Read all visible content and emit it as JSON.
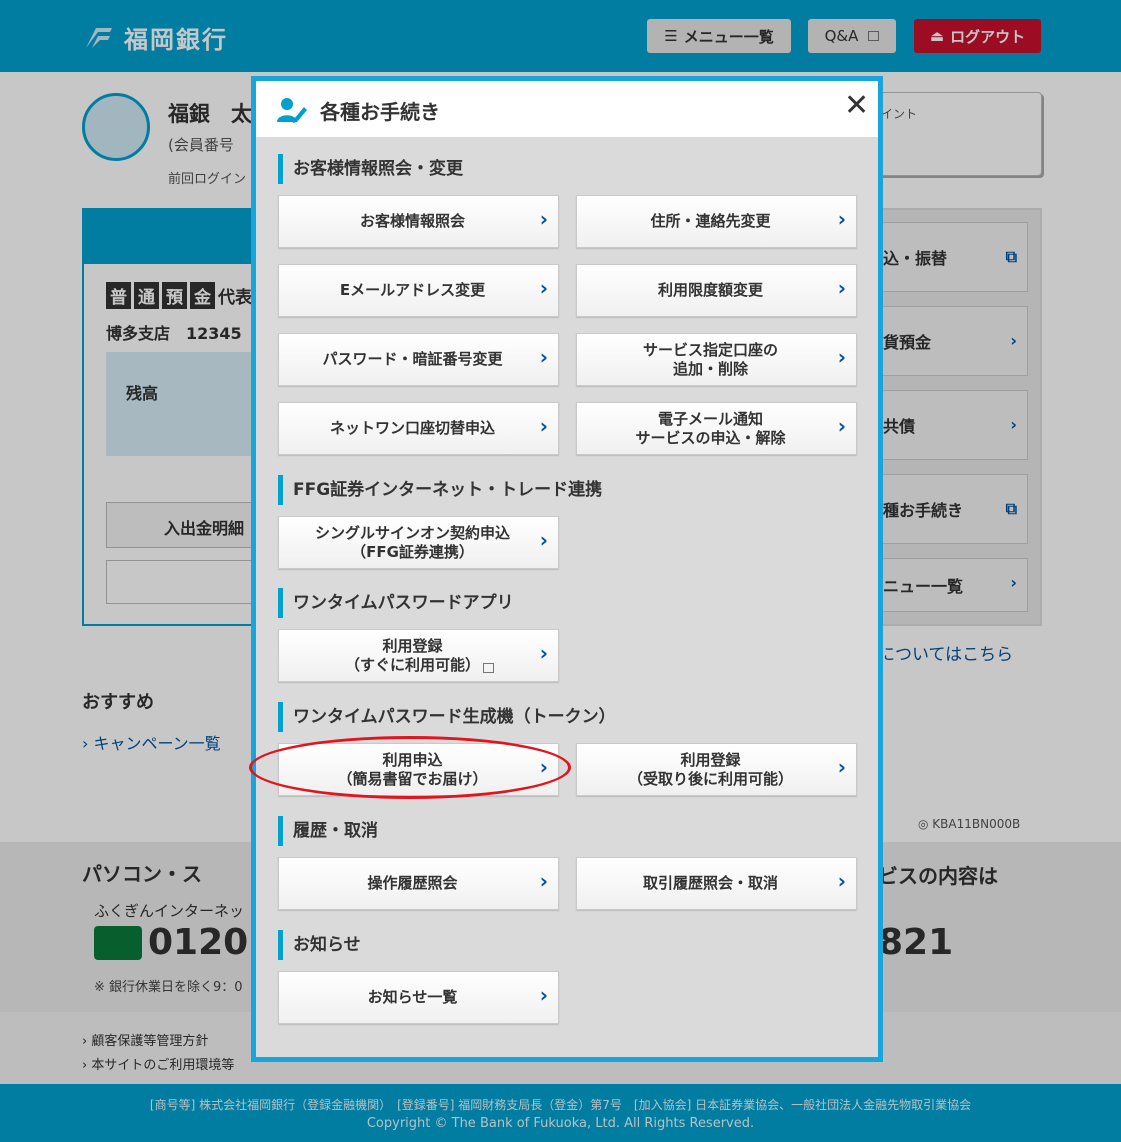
{
  "header": {
    "logo_text": "福岡銀行",
    "menu_button": "メニュー一覧",
    "qa_button": "Q&A",
    "logout_button": "ログアウト"
  },
  "background": {
    "user_name": "福銀　太",
    "member_no": "(会員番号",
    "last_login": "前回ログイン",
    "points": "イント",
    "account_type_chars": [
      "普",
      "通",
      "預",
      "金"
    ],
    "account_rep": "代表",
    "account_branch": "博多支店　12345",
    "balance_label": "残高",
    "detail_button": "入出金明細",
    "side_items": [
      "込・振替",
      "貨預金",
      "共債",
      "種お手続き",
      "ニュー一覧"
    ],
    "link_here": "についてはこちら",
    "recommend": "おすすめ",
    "campaign_link": "キャンペーン一覧",
    "screen_code": "◎ KBA11BN000B",
    "pc_title": "パソコン・ス",
    "pc_sub": "ふくぎんインターネッ",
    "tel": "0120",
    "tel_note": "※ 銀行休業日を除く9：0",
    "service_title": "ビスの内容は",
    "tel2": "821",
    "footer_links": [
      "顧客保護等管理方針",
      "本サイトのご利用環境等"
    ]
  },
  "footer": {
    "line1": "[商号等] 株式会社福岡銀行（登録金融機関）　[登録番号] 福岡財務支局長（登金）第7号　[加入協会] 日本証券業協会、一般社団法人金融先物取引業協会",
    "line2": "Copyright © The Bank of Fukuoka, Ltd. All Rights Reserved."
  },
  "modal": {
    "title": "各種お手続き",
    "close": "✕",
    "sections": [
      "お客様情報照会・変更",
      "FFG証券インターネット・トレード連携",
      "ワンタイムパスワードアプリ",
      "ワンタイムパスワード生成機（トークン）",
      "履歴・取消",
      "お知らせ"
    ],
    "buttons": {
      "customer_info": "お客様情報照会",
      "address_change": "住所・連絡先変更",
      "email_change": "Eメールアドレス変更",
      "limit_change": "利用限度額変更",
      "password_change": "パスワード・暗証番号変更",
      "service_account": "サービス指定口座の\n追加・削除",
      "netone_switch": "ネットワン口座切替申込",
      "email_notify": "電子メール通知\nサービスの申込・解除",
      "single_signon": "シングルサインオン契約申込\n（FFG証券連携）",
      "app_register": "利用登録\n（すぐに利用可能）",
      "token_apply": "利用申込\n（簡易書留でお届け）",
      "token_register": "利用登録\n（受取り後に利用可能）",
      "op_history": "操作履歴照会",
      "tx_history": "取引履歴照会・取消",
      "notice_list": "お知らせ一覧"
    },
    "arrow": "›"
  }
}
